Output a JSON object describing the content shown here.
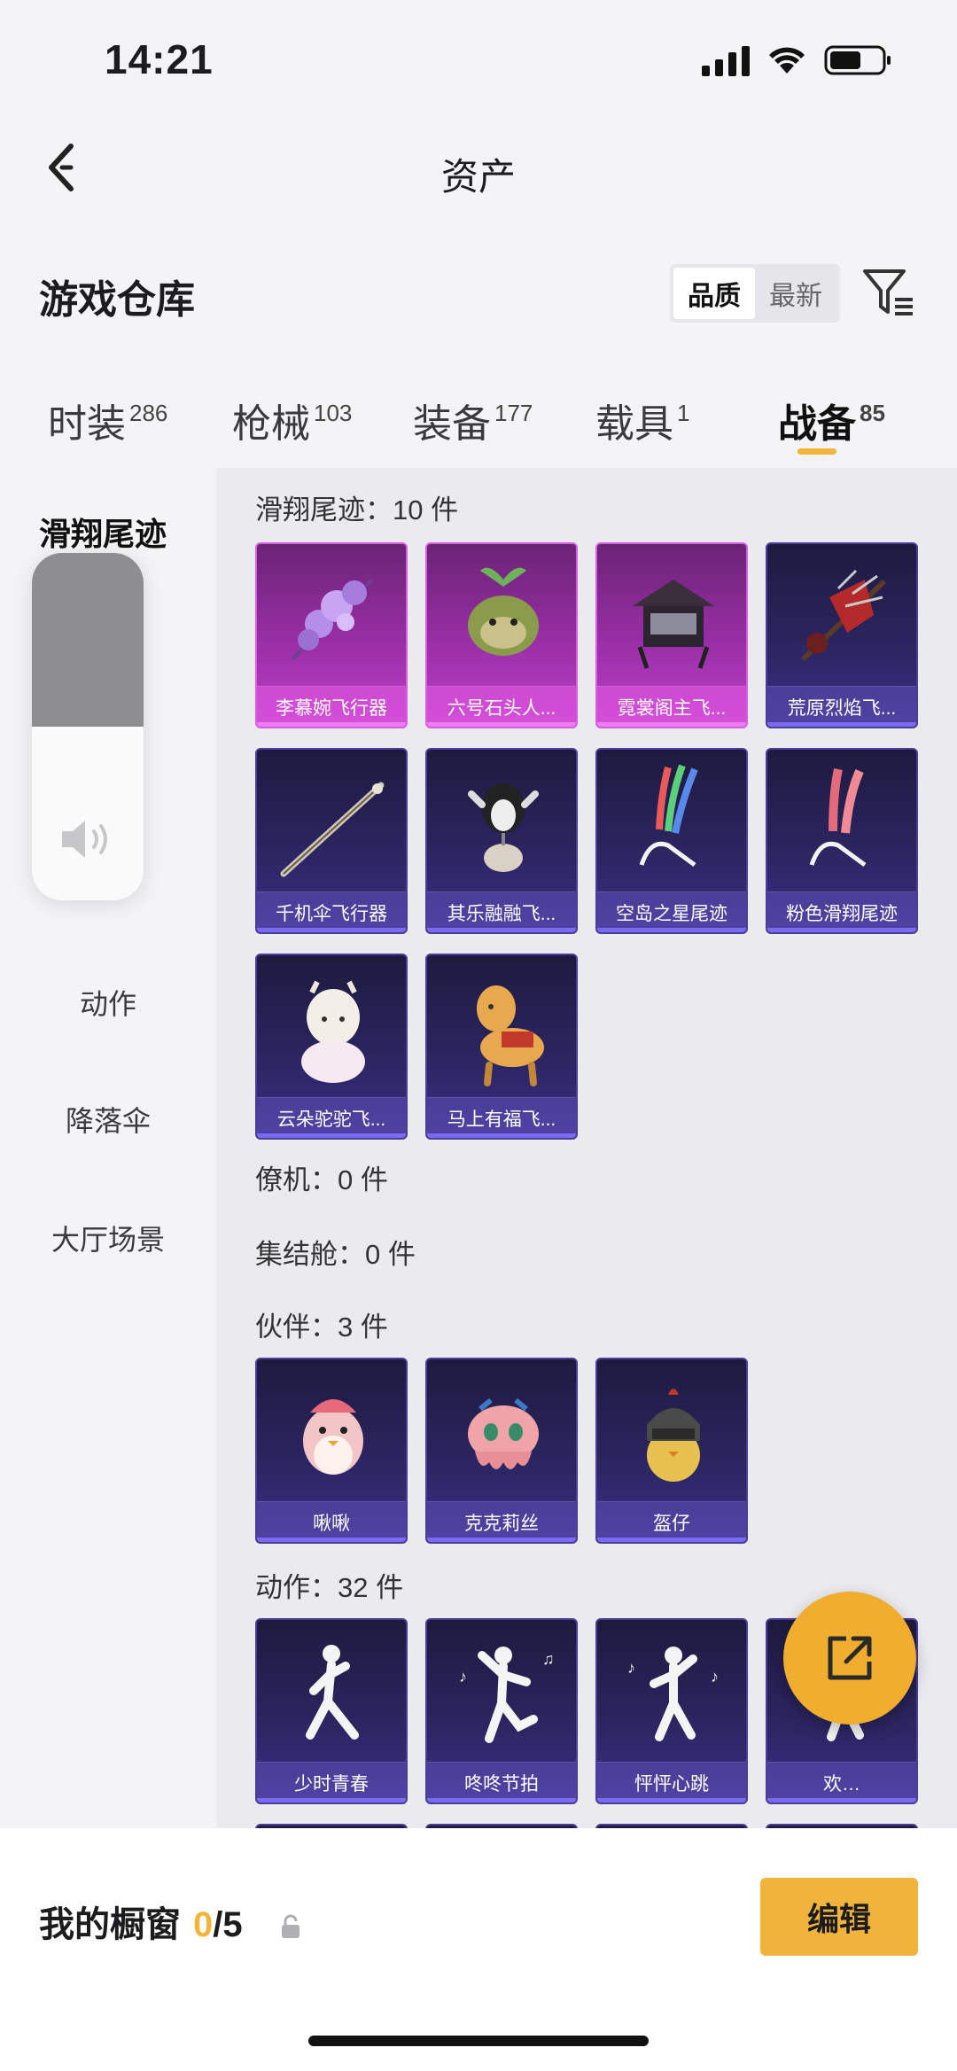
{
  "status": {
    "time": "14:21"
  },
  "nav": {
    "title": "资产"
  },
  "warehouse": {
    "title": "游戏仓库",
    "sort_options": [
      "品质",
      "最新"
    ],
    "sort_selected": "品质"
  },
  "tabs": [
    {
      "label": "时装",
      "count": "286"
    },
    {
      "label": "枪械",
      "count": "103"
    },
    {
      "label": "装备",
      "count": "177"
    },
    {
      "label": "载具",
      "count": "1"
    },
    {
      "label": "战备",
      "count": "85",
      "active": true
    }
  ],
  "sidebar": {
    "items": [
      "滑翔尾迹",
      "动作",
      "降落伞",
      "大厅场景"
    ],
    "partial_item_glyph": "迹",
    "selected": "滑翔尾迹"
  },
  "sections": [
    {
      "title": "滑翔尾迹：10 件",
      "items": [
        {
          "label": "李慕婉飞行器",
          "rarity": "pink",
          "icon": "flower-glider-icon"
        },
        {
          "label": "六号石头人...",
          "rarity": "pink",
          "icon": "stone-creature-icon"
        },
        {
          "label": "霓裳阁主飞...",
          "rarity": "pink",
          "icon": "pavilion-glider-icon"
        },
        {
          "label": "荒原烈焰飞...",
          "rarity": "purple",
          "icon": "flame-glider-icon"
        },
        {
          "label": "千机伞飞行器",
          "rarity": "purple",
          "icon": "umbrella-glider-icon"
        },
        {
          "label": "其乐融融飞...",
          "rarity": "purple",
          "icon": "penguin-glider-icon"
        },
        {
          "label": "空岛之星尾迹",
          "rarity": "purple",
          "icon": "rainbow-trail-icon"
        },
        {
          "label": "粉色滑翔尾迹",
          "rarity": "purple",
          "icon": "pink-trail-icon"
        },
        {
          "label": "云朵驼驼飞...",
          "rarity": "purple",
          "icon": "alpaca-glider-icon"
        },
        {
          "label": "马上有福飞...",
          "rarity": "purple",
          "icon": "horse-glider-icon"
        }
      ]
    },
    {
      "title": "僚机：0 件",
      "items": []
    },
    {
      "title": "集结舱：0 件",
      "items": []
    },
    {
      "title": "伙伴：3 件",
      "items": [
        {
          "label": "啾啾",
          "rarity": "purple",
          "icon": "pink-bird-icon"
        },
        {
          "label": "克克莉丝",
          "rarity": "purple",
          "icon": "octopus-icon"
        },
        {
          "label": "盔仔",
          "rarity": "purple",
          "icon": "helmet-chick-icon"
        }
      ]
    },
    {
      "title": "动作：32 件",
      "items": [
        {
          "label": "少时青春",
          "rarity": "purple",
          "icon": "dance-pose-icon"
        },
        {
          "label": "咚咚节拍",
          "rarity": "purple",
          "icon": "dance-pose-icon"
        },
        {
          "label": "怦怦心跳",
          "rarity": "purple",
          "icon": "dance-pose-icon"
        },
        {
          "label": "欢…",
          "rarity": "purple",
          "icon": "dance-pose-icon"
        }
      ]
    }
  ],
  "showcase": {
    "title": "我的橱窗",
    "current": "0",
    "total": "/5",
    "edit_label": "编辑"
  },
  "colors": {
    "accent": "#f2b53a",
    "card_purple": "#2b2560",
    "card_pink": "#9a2fa7"
  }
}
